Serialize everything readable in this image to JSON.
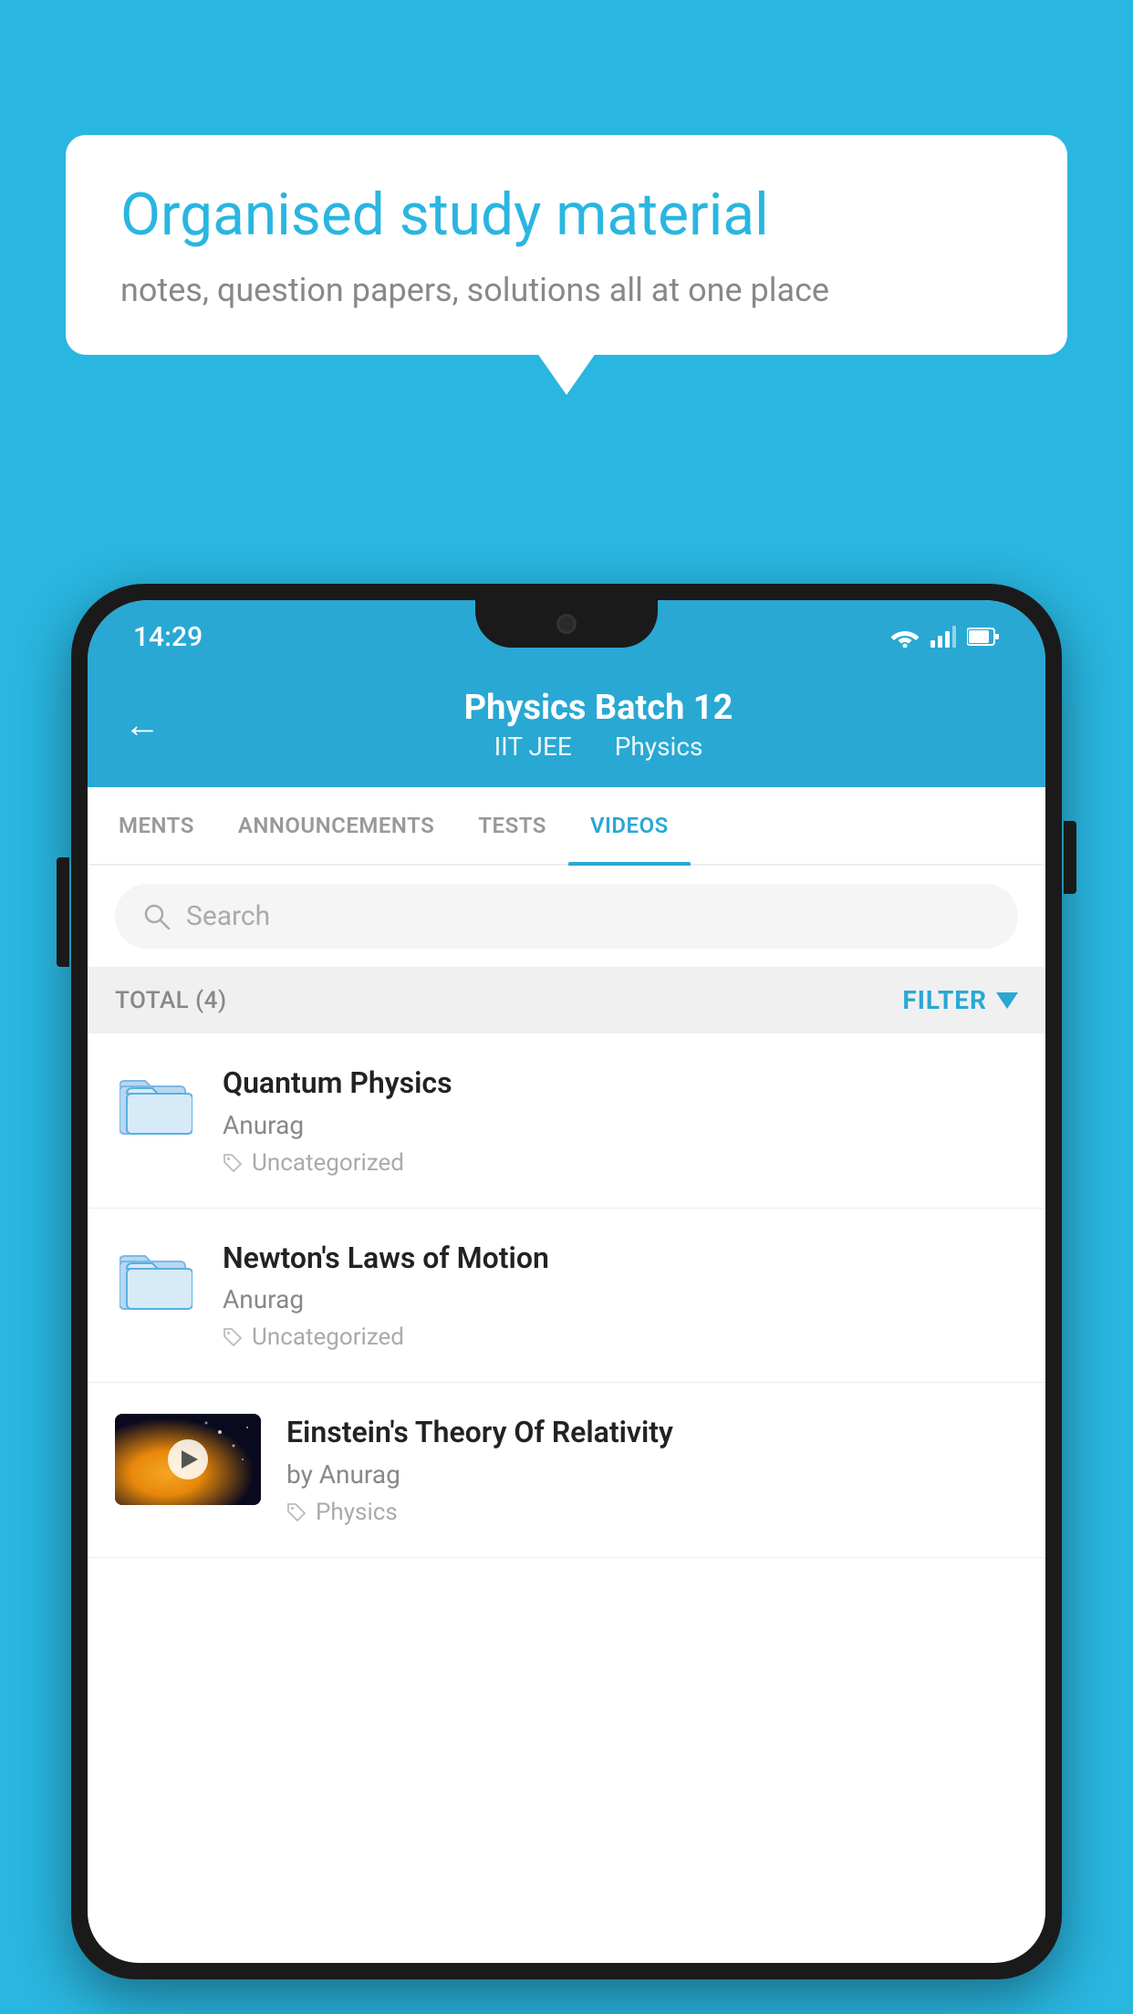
{
  "background_color": "#29b6e0",
  "speech_bubble": {
    "title": "Organised study material",
    "subtitle": "notes, question papers, solutions all at one place"
  },
  "status_bar": {
    "time": "14:29",
    "icons": [
      "wifi",
      "signal",
      "battery"
    ]
  },
  "header": {
    "back_label": "←",
    "title": "Physics Batch 12",
    "subtitle_part1": "IIT JEE",
    "subtitle_part2": "Physics"
  },
  "tabs": [
    {
      "label": "MENTS",
      "active": false
    },
    {
      "label": "ANNOUNCEMENTS",
      "active": false
    },
    {
      "label": "TESTS",
      "active": false
    },
    {
      "label": "VIDEOS",
      "active": true
    }
  ],
  "search": {
    "placeholder": "Search"
  },
  "filter_bar": {
    "total_label": "TOTAL (4)",
    "filter_label": "FILTER"
  },
  "videos": [
    {
      "id": 1,
      "title": "Quantum Physics",
      "author": "Anurag",
      "tag": "Uncategorized",
      "has_thumbnail": false
    },
    {
      "id": 2,
      "title": "Newton's Laws of Motion",
      "author": "Anurag",
      "tag": "Uncategorized",
      "has_thumbnail": false
    },
    {
      "id": 3,
      "title": "Einstein's Theory Of Relativity",
      "author": "by Anurag",
      "tag": "Physics",
      "has_thumbnail": true
    }
  ]
}
